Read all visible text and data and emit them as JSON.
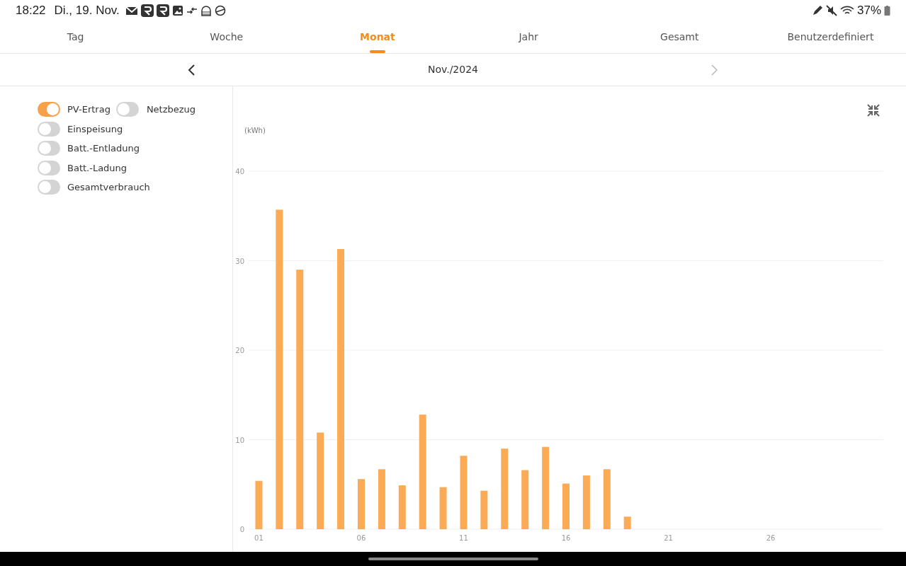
{
  "status_bar": {
    "time": "18:22",
    "date": "Di., 19. Nov.",
    "battery": "37%"
  },
  "tabs": [
    {
      "label": "Tag",
      "selected": false
    },
    {
      "label": "Woche",
      "selected": false
    },
    {
      "label": "Monat",
      "selected": true
    },
    {
      "label": "Jahr",
      "selected": false
    },
    {
      "label": "Gesamt",
      "selected": false
    },
    {
      "label": "Benutzerdefiniert",
      "selected": false
    }
  ],
  "period": {
    "label": "Nov./2024",
    "next_disabled": true
  },
  "series_toggles": [
    {
      "label": "PV-Ertrag",
      "on": true
    },
    {
      "label": "Netzbezug",
      "on": false
    },
    {
      "label": "Einspeisung",
      "on": false
    },
    {
      "label": "Batt.-Entladung",
      "on": false
    },
    {
      "label": "Batt.-Ladung",
      "on": false
    },
    {
      "label": "Gesamtverbrauch",
      "on": false
    }
  ],
  "chart": {
    "chart_data": {
      "type": "bar",
      "ylabel": "(kWh)",
      "grid": true,
      "xlim": [
        0.5,
        31.5
      ],
      "x": [
        1,
        2,
        3,
        4,
        5,
        6,
        7,
        8,
        9,
        10,
        11,
        12,
        13,
        14,
        15,
        16,
        17,
        18,
        19
      ],
      "series": [
        {
          "color": "#fbaa55",
          "values": [
            5.4,
            35.7,
            29.0,
            10.8,
            31.3,
            5.6,
            6.7,
            4.9,
            12.8,
            4.7,
            8.2,
            4.3,
            9.0,
            6.6,
            9.2,
            5.1,
            6.0,
            6.7,
            1.4
          ]
        }
      ],
      "ylim": [
        0,
        40
      ],
      "yticks": [
        0,
        10,
        20,
        30,
        40
      ],
      "xticks": [
        {
          "value": 1,
          "label": "01"
        },
        {
          "value": 6,
          "label": "06"
        },
        {
          "value": 11,
          "label": "11"
        },
        {
          "value": 16,
          "label": "16"
        },
        {
          "value": 21,
          "label": "21"
        },
        {
          "value": 26,
          "label": "26"
        }
      ]
    }
  }
}
